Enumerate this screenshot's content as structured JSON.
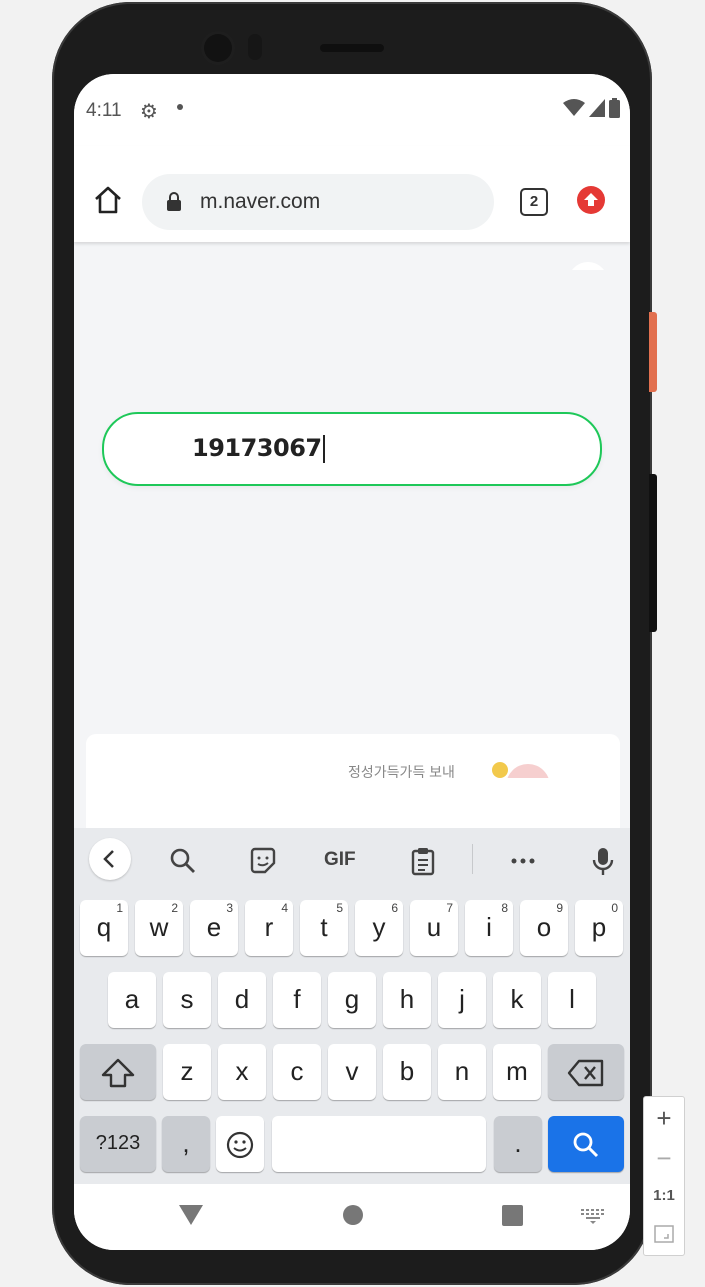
{
  "status_bar": {
    "time": "4:11"
  },
  "browser": {
    "url": "m.naver.com",
    "tab_count": "2"
  },
  "search": {
    "query": "19173067"
  },
  "card": {
    "partial_text": "정성가득가득 보내"
  },
  "keyboard": {
    "toolbar": [
      "back",
      "search",
      "sticker",
      "GIF",
      "clipboard",
      "more",
      "mic"
    ],
    "gif_label": "GIF",
    "row1": [
      {
        "k": "q",
        "n": "1"
      },
      {
        "k": "w",
        "n": "2"
      },
      {
        "k": "e",
        "n": "3"
      },
      {
        "k": "r",
        "n": "4"
      },
      {
        "k": "t",
        "n": "5"
      },
      {
        "k": "y",
        "n": "6"
      },
      {
        "k": "u",
        "n": "7"
      },
      {
        "k": "i",
        "n": "8"
      },
      {
        "k": "o",
        "n": "9"
      },
      {
        "k": "p",
        "n": "0"
      }
    ],
    "row2": [
      "a",
      "s",
      "d",
      "f",
      "g",
      "h",
      "j",
      "k",
      "l"
    ],
    "row3": [
      "z",
      "x",
      "c",
      "v",
      "b",
      "n",
      "m"
    ],
    "symbols_label": "?123",
    "comma_label": ",",
    "period_label": "."
  },
  "zoom_panel": {
    "one_to_one": "1:1"
  },
  "colors": {
    "accent_green": "#1ec859",
    "keyboard_search_blue": "#1a73e8",
    "update_red": "#e53935"
  }
}
